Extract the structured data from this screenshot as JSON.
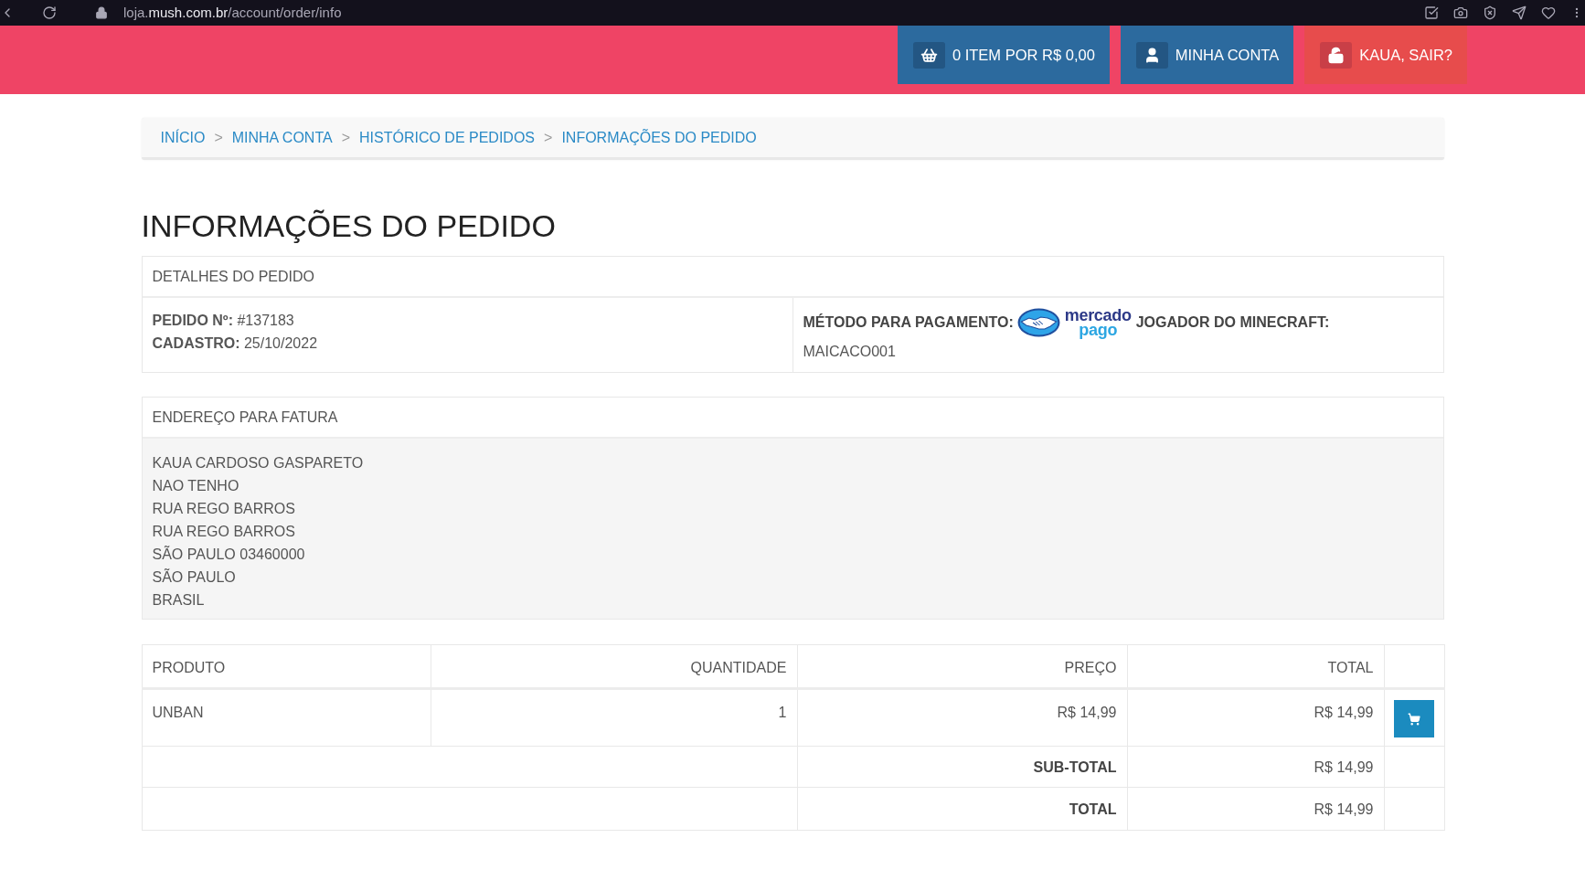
{
  "browser": {
    "url_parts": [
      {
        "text": "loja.",
        "emphasis": false
      },
      {
        "text": "mush.com.br",
        "emphasis": true
      },
      {
        "text": "/account/order/info",
        "emphasis": false
      }
    ]
  },
  "header": {
    "buttons": [
      {
        "kind": "cart",
        "label": "0 ITEM POR R$ 0,00"
      },
      {
        "kind": "account",
        "label": "MINHA CONTA"
      },
      {
        "kind": "logout",
        "label": "KAUA, SAIR?"
      }
    ]
  },
  "breadcrumb": [
    {
      "label": "INÍCIO"
    },
    {
      "separator": ">",
      "label": "MINHA CONTA"
    },
    {
      "separator": ">",
      "label": "HISTÓRICO DE PEDIDOS"
    },
    {
      "separator": ">",
      "label": "INFORMAÇÕES DO PEDIDO"
    }
  ],
  "page_title": "INFORMAÇÕES DO PEDIDO",
  "order_details": {
    "heading": "DETALHES DO PEDIDO",
    "lines": [
      "**PEDIDO Nº:** #137183",
      "**CADASTRO:** 25/10/2022"
    ],
    "payment_label": "MÉTODO PARA PAGAMENTO:",
    "payment_logo": [
      "mercado",
      "pago"
    ],
    "player_label": "JOGADOR DO MINECRAFT:",
    "player_name": "MAICACO001"
  },
  "billing_address": {
    "heading": "ENDEREÇO PARA FATURA",
    "lines": [
      "KAUA CARDOSO GASPARETO",
      "NAO TENHO",
      "RUA REGO BARROS",
      "RUA REGO BARROS",
      "SÃO PAULO 03460000",
      "SÃO PAULO",
      "BRASIL"
    ]
  },
  "products": {
    "columns": [
      "PRODUTO",
      "QUANTIDADE",
      "PREÇO",
      "TOTAL"
    ],
    "rows": [
      {
        "product": "UNBAN",
        "quantity": "1",
        "price": "R$ 14,99",
        "total": "R$ 14,99"
      }
    ],
    "totals": [
      {
        "label": "SUB-TOTAL",
        "value": "R$ 14,99"
      },
      {
        "label": "TOTAL",
        "value": "R$ 14,99"
      }
    ]
  }
}
